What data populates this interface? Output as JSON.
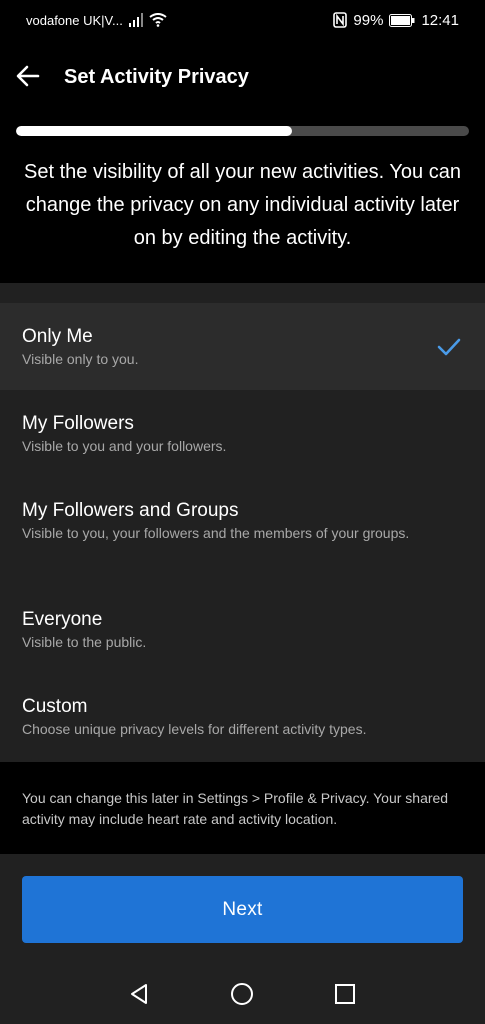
{
  "status_bar": {
    "carrier": "vodafone UK|V...",
    "battery": "99%",
    "time": "12:41"
  },
  "header": {
    "title": "Set Activity Privacy"
  },
  "progress": {
    "fraction": 0.61
  },
  "intro": "Set the visibility of all your new activities. You can change the privacy on any individual activity later on by editing the activity.",
  "options": [
    {
      "title": "Only Me",
      "description": "Visible only to you.",
      "selected": true
    },
    {
      "title": "My Followers",
      "description": "Visible to you and your followers.",
      "selected": false
    },
    {
      "title": "My Followers and Groups",
      "description": "Visible to you, your followers and the members of your groups.",
      "selected": false
    },
    {
      "title": "Everyone",
      "description": "Visible to the public.",
      "selected": false
    },
    {
      "title": "Custom",
      "description": "Choose unique privacy levels for different activity types.",
      "selected": false
    }
  ],
  "note": "You can change this later in Settings > Profile & Privacy. Your shared activity may include heart rate and activity location.",
  "next_button": "Next",
  "colors": {
    "accent": "#1f74d6",
    "check": "#4a9be8",
    "background": "#212121"
  },
  "icons": {
    "back": "arrow-left-icon",
    "check": "checkmark-icon",
    "nav_back": "triangle-back-icon",
    "nav_home": "circle-home-icon",
    "nav_recents": "square-recents-icon"
  }
}
